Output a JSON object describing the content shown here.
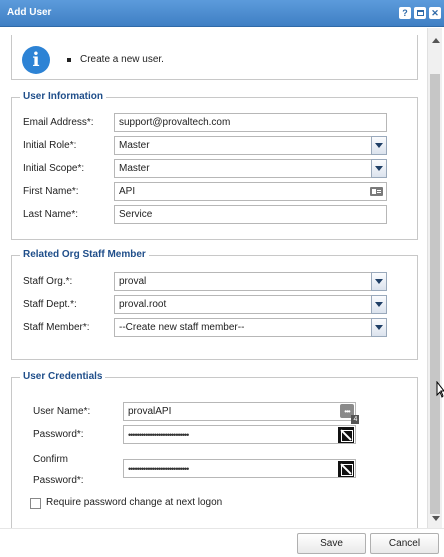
{
  "window": {
    "title": "Add User"
  },
  "info": {
    "message": "Create a new user."
  },
  "user_information": {
    "legend": "User Information",
    "email_label": "Email Address*:",
    "email_value": "support@provaltech.com",
    "role_label": "Initial Role*:",
    "role_value": "Master",
    "scope_label": "Initial Scope*:",
    "scope_value": "Master",
    "first_name_label": "First Name*:",
    "first_name_value": "API",
    "last_name_label": "Last Name*:",
    "last_name_value": "Service"
  },
  "related_staff": {
    "legend": "Related Org Staff Member",
    "org_label": "Staff Org.*:",
    "org_value": "proval",
    "dept_label": "Staff Dept.*:",
    "dept_value": "proval.root",
    "member_label": "Staff Member*:",
    "member_value": "--Create new staff member--"
  },
  "credentials": {
    "legend": "User Credentials",
    "username_label": "User Name*:",
    "username_value": "provalAPI",
    "username_badge": "4",
    "password_label": "Password*:",
    "password_value": "••••••••••••••••••••••••••••",
    "confirm_label_line1": "Confirm",
    "confirm_label_line2": "Password*:",
    "confirm_value": "••••••••••••••••••••••••••••",
    "require_change_label": "Require password change at next logon"
  },
  "footer": {
    "save_label": "Save",
    "cancel_label": "Cancel"
  },
  "colors": {
    "titlebar": "#4a8ad0",
    "legend": "#1f4e8a",
    "info_icon": "#2d83d5"
  }
}
